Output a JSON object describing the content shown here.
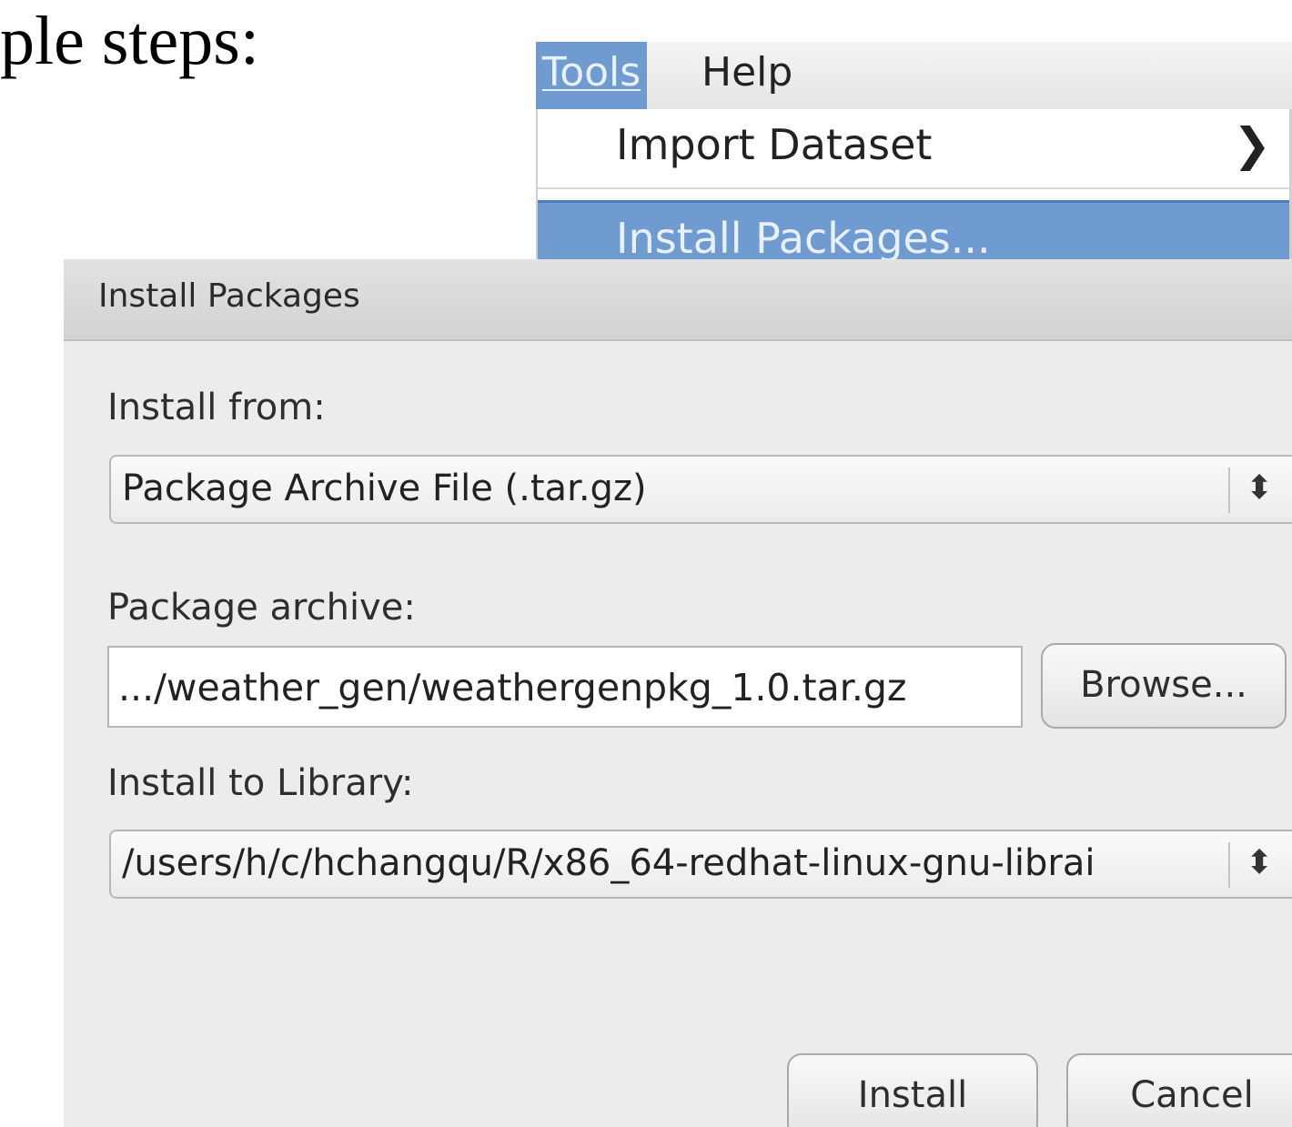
{
  "slide": {
    "text": "ple steps:"
  },
  "menubar": {
    "tools": "Tools",
    "help": "Help"
  },
  "menu": {
    "import_dataset": "Import Dataset",
    "install_packages": "Install Packages..."
  },
  "dialog": {
    "title": "Install Packages",
    "install_from_label": "Install from:",
    "install_from_value": "Package Archive File (.tar.gz)",
    "package_archive_label": "Package archive:",
    "package_archive_value": ".../weather_gen/weathergenpkg_1.0.tar.gz",
    "browse_button": "Browse...",
    "install_to_label": "Install to Library:",
    "install_to_value": "/users/h/c/hchangqu/R/x86_64-redhat-linux-gnu-librai",
    "install_button": "Install",
    "cancel_button": "Cancel"
  },
  "colors": {
    "highlight": "#6f9bd1",
    "dialog_bg": "#ececec"
  },
  "icons": {
    "submenu_arrow": "chevron-right-icon",
    "select_spinner": "up-down-arrows-icon"
  }
}
